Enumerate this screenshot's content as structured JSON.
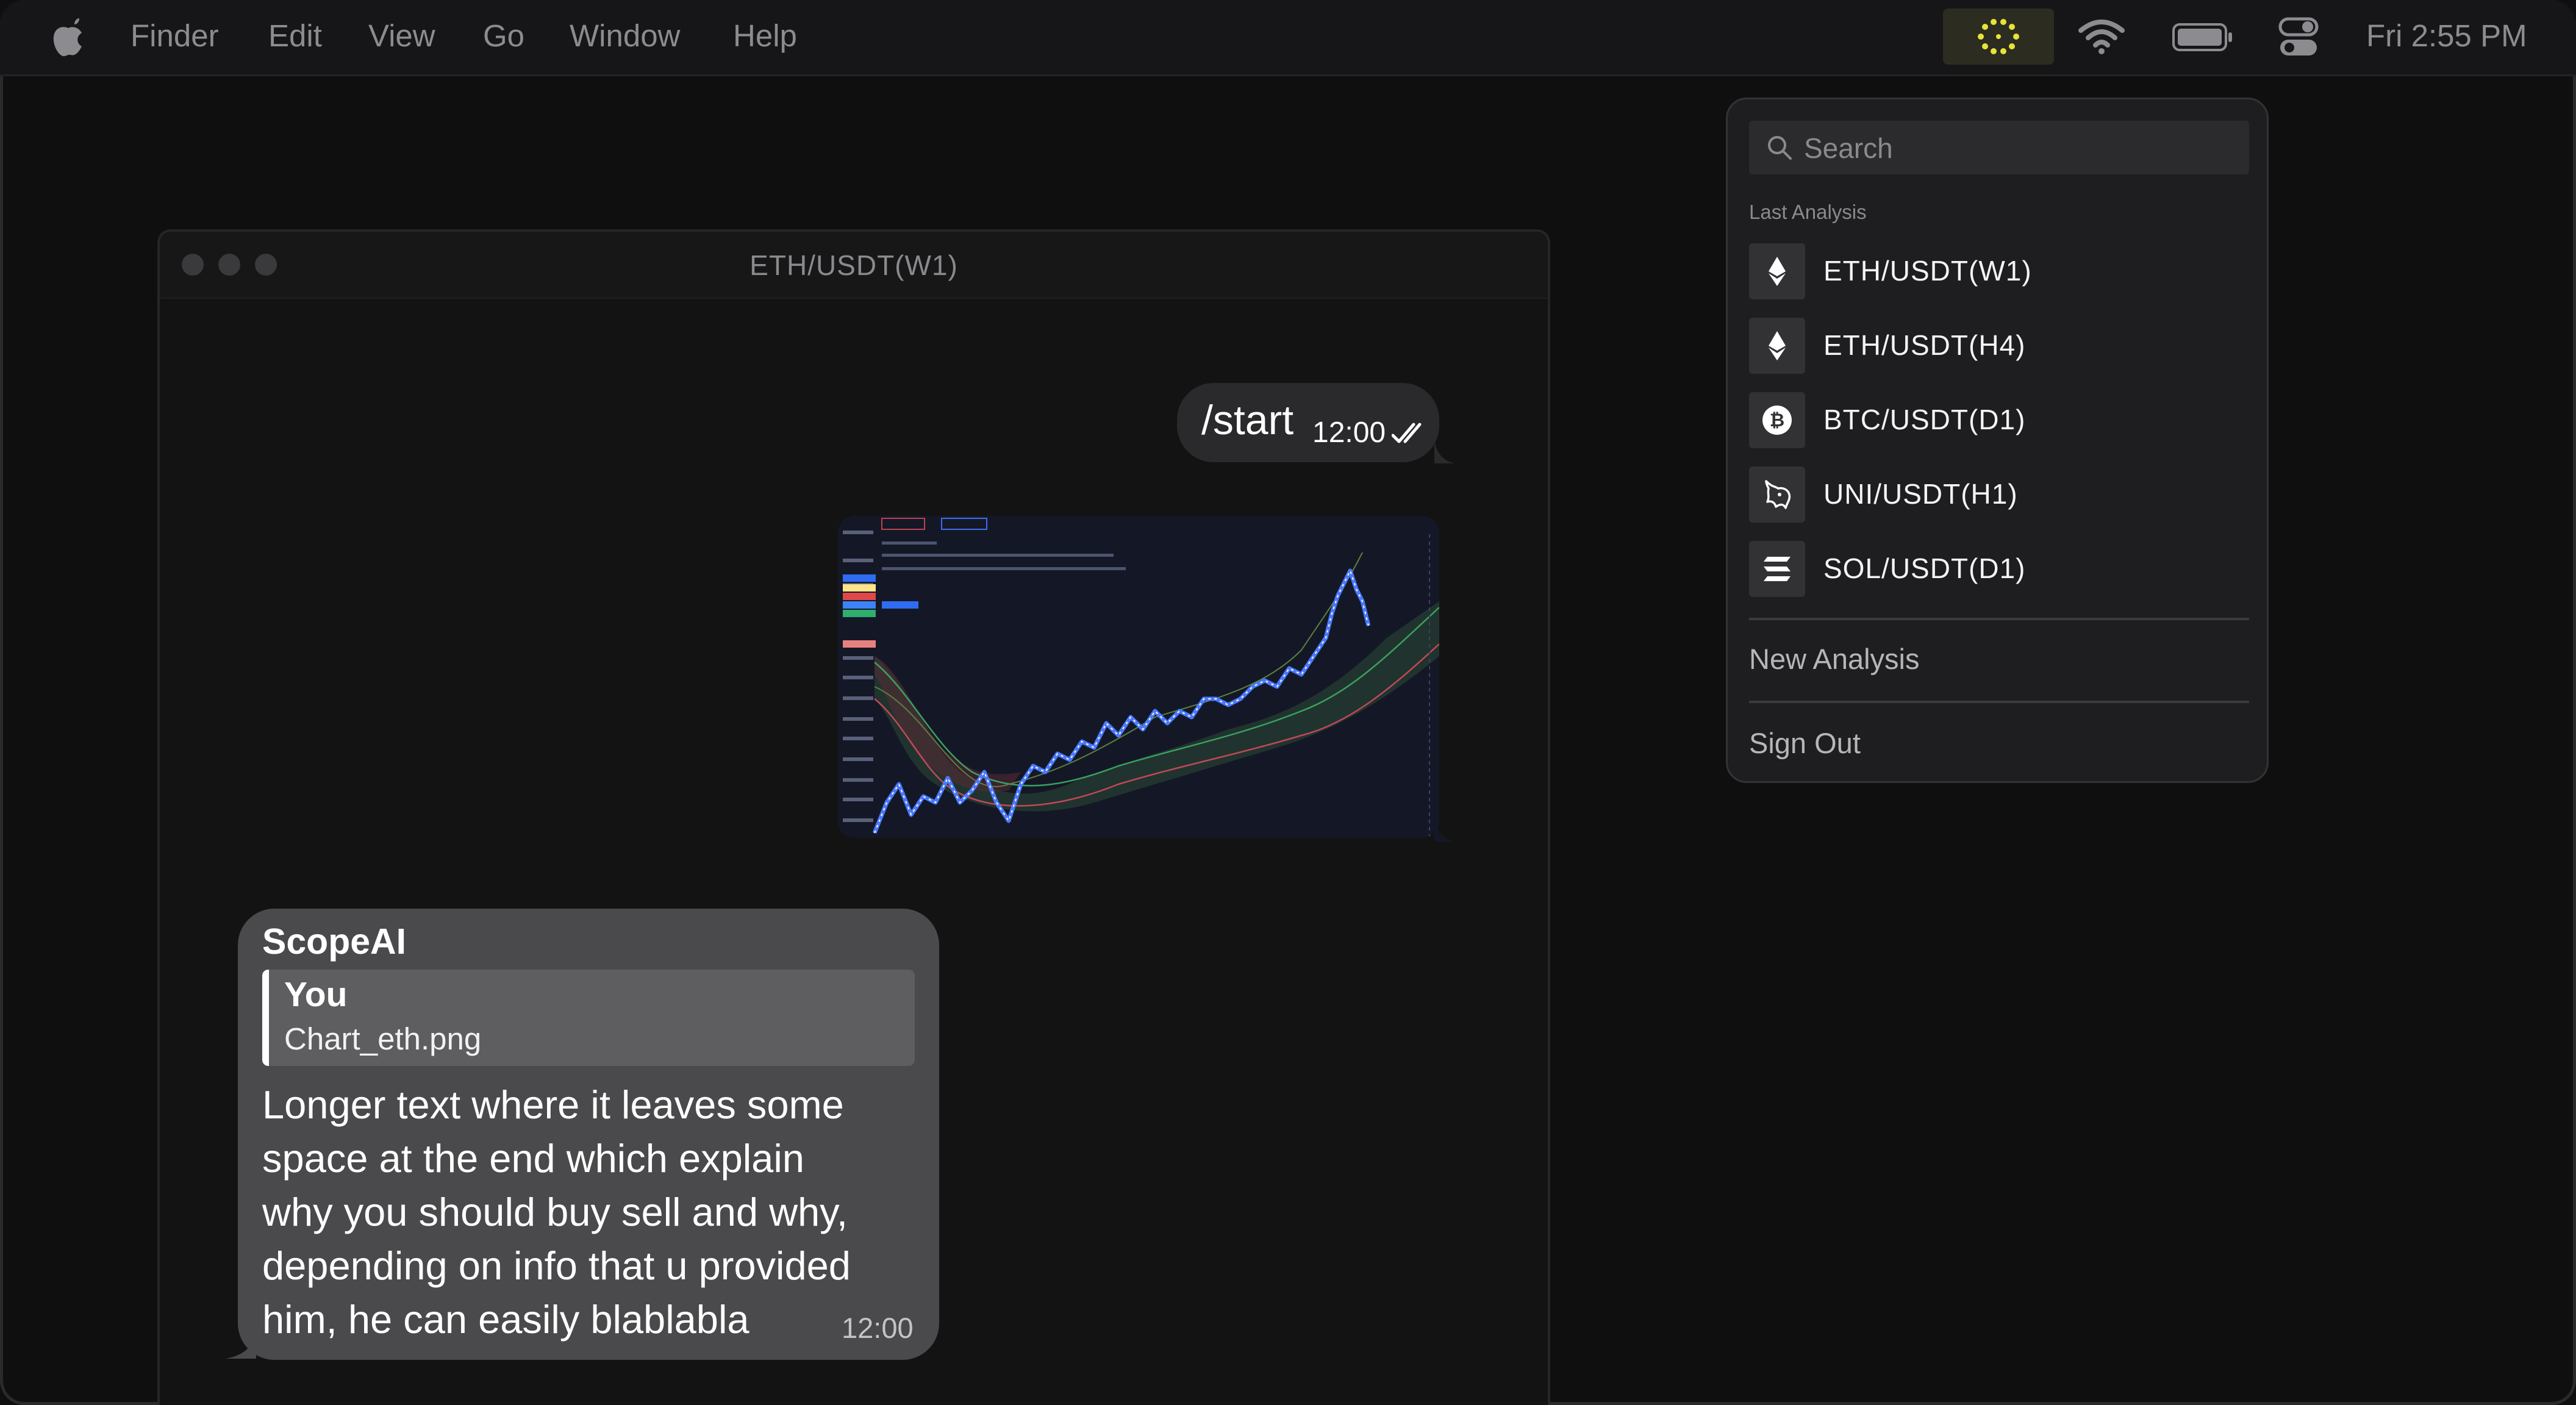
{
  "menubar": {
    "app_name": "Finder",
    "items": [
      "Edit",
      "View",
      "Go",
      "Window",
      "Help"
    ],
    "clock": "Fri 2:55 PM",
    "status_icons": [
      "scope-ai-dots-icon",
      "wifi-icon",
      "battery-icon",
      "control-center-icon"
    ],
    "accent_color": "#e8e337"
  },
  "window": {
    "title": "ETH/USDT(W1)"
  },
  "chat": {
    "outgoing": {
      "text": "/start",
      "time": "12:00",
      "read_receipt": "double-check-icon"
    },
    "image": {
      "description_icon": "price-chart-thumbnail"
    },
    "incoming": {
      "sender": "ScopeAI",
      "reply_author": "You",
      "reply_text": "Chart_eth.png",
      "text": "Longer text where it leaves some space at the end which explain why you should buy sell and why, depending on info that u provided him, he can easily blablabla",
      "time": "12:00"
    }
  },
  "dropdown": {
    "search_placeholder": "Search",
    "section_label": "Last Analysis",
    "items": [
      {
        "label": "ETH/USDT(W1)",
        "icon": "ethereum-icon"
      },
      {
        "label": "ETH/USDT(H4)",
        "icon": "ethereum-icon"
      },
      {
        "label": "BTC/USDT(D1)",
        "icon": "bitcoin-icon"
      },
      {
        "label": "UNI/USDT(H1)",
        "icon": "uniswap-icon"
      },
      {
        "label": "SOL/USDT(D1)",
        "icon": "solana-icon"
      }
    ],
    "new_analysis": "New Analysis",
    "sign_out": "Sign Out"
  }
}
